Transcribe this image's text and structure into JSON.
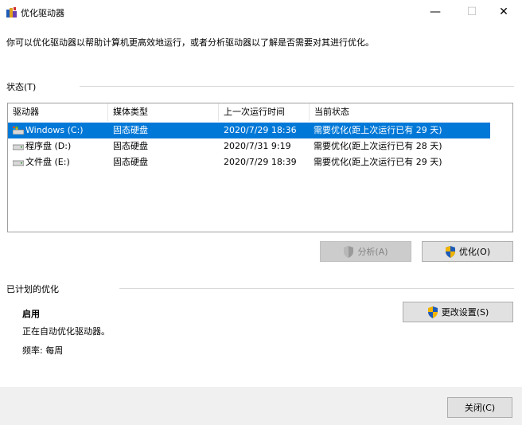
{
  "window": {
    "title": "优化驱动器",
    "minimize": "—",
    "maximize": "☐",
    "close": "✕"
  },
  "description": "你可以优化驱动器以帮助计算机更高效地运行，或者分析驱动器以了解是否需要对其进行优化。",
  "status_section": {
    "label": "状态(T)",
    "columns": [
      "驱动器",
      "媒体类型",
      "上一次运行时间",
      "当前状态"
    ],
    "rows": [
      {
        "drive": "Windows (C:)",
        "media": "固态硬盘",
        "last_run": "2020/7/29 18:36",
        "status": "需要优化(距上次运行已有 29 天)",
        "selected": true
      },
      {
        "drive": "程序盘 (D:)",
        "media": "固态硬盘",
        "last_run": "2020/7/31 9:19",
        "status": "需要优化(距上次运行已有 28 天)",
        "selected": false
      },
      {
        "drive": "文件盘 (E:)",
        "media": "固态硬盘",
        "last_run": "2020/7/29 18:39",
        "status": "需要优化(距上次运行已有 29 天)",
        "selected": false
      }
    ]
  },
  "buttons": {
    "analyze": "分析(A)",
    "optimize": "优化(O)",
    "change_settings": "更改设置(S)",
    "close": "关闭(C)"
  },
  "scheduled": {
    "label": "已计划的优化",
    "state": "启用",
    "detail": "正在自动优化驱动器。",
    "frequency": "频率: 每周"
  },
  "colors": {
    "selection": "#0078d7",
    "footer": "#f0f0f0"
  }
}
